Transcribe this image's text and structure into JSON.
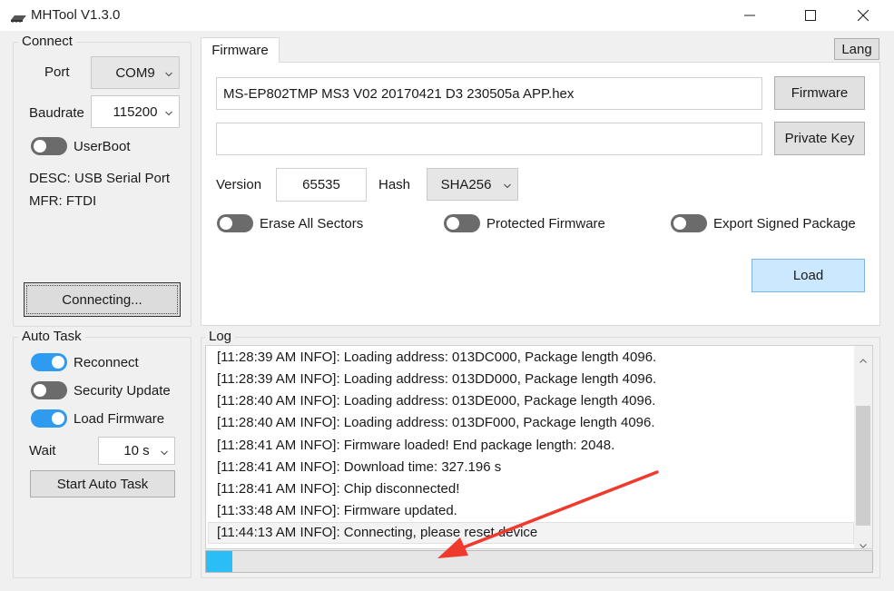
{
  "window": {
    "title": "MHTool V1.3.0"
  },
  "connect": {
    "title": "Connect",
    "port_label": "Port",
    "port_value": "COM9",
    "baud_label": "Baudrate",
    "baud_value": "115200",
    "userboot_label": "UserBoot",
    "userboot_on": false,
    "desc": "DESC: USB Serial Port",
    "mfr": "MFR: FTDI",
    "connect_button": "Connecting..."
  },
  "autotask": {
    "title": "Auto Task",
    "reconnect_label": "Reconnect",
    "reconnect_on": true,
    "security_label": "Security Update",
    "security_on": false,
    "loadfw_label": "Load Firmware",
    "loadfw_on": true,
    "wait_label": "Wait",
    "wait_value": "10 s",
    "start_button": "Start Auto Task"
  },
  "firmware": {
    "tab_label": "Firmware",
    "lang_button": "Lang",
    "file_value": "MS-EP802TMP MS3 V02 20170421 D3 230505a APP.hex",
    "firmware_button": "Firmware",
    "key_value": "",
    "private_key_button": "Private Key",
    "version_label": "Version",
    "version_value": "65535",
    "hash_label": "Hash",
    "hash_value": "SHA256",
    "erase_label": "Erase All Sectors",
    "erase_on": false,
    "protected_label": "Protected Firmware",
    "protected_on": false,
    "export_label": "Export Signed Package",
    "export_on": false,
    "load_button": "Load"
  },
  "log": {
    "title": "Log",
    "lines": [
      "[11:28:39 AM INFO]: Loading address: 013DC000, Package length 4096.",
      "[11:28:39 AM INFO]: Loading address: 013DD000, Package length 4096.",
      "[11:28:40 AM INFO]: Loading address: 013DE000, Package length 4096.",
      "[11:28:40 AM INFO]: Loading address: 013DF000, Package length 4096.",
      "[11:28:41 AM INFO]: Firmware loaded! End package length: 2048.",
      "[11:28:41 AM INFO]: Download time: 327.196 s",
      "[11:28:41 AM INFO]: Chip disconnected!",
      "[11:33:48 AM INFO]: Firmware updated.",
      "[11:44:13 AM INFO]: Connecting, please reset device"
    ],
    "progress_percent": 4
  },
  "colors": {
    "toggle_on": "#2e9bf0",
    "toggle_off": "#6b6b6b",
    "progress_fill": "#2bbdf5",
    "load_button_bg": "#cce8ff",
    "annotation_arrow": "#f03a2e"
  },
  "icons": {
    "app": "chip-icon",
    "minimize": "minimize-icon",
    "maximize": "maximize-icon",
    "close": "close-icon",
    "dropdown": "chevron-down-icon"
  }
}
